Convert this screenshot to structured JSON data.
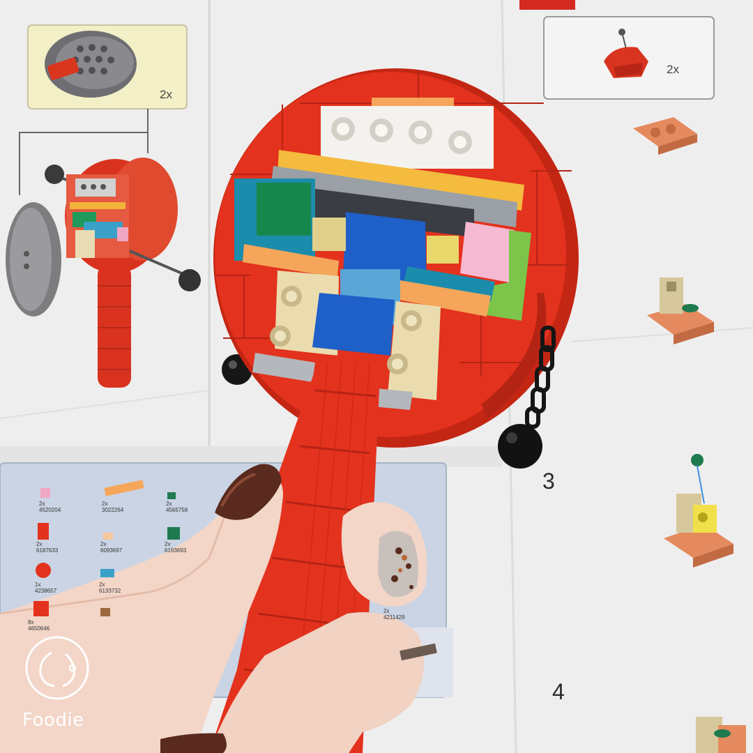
{
  "instructions": {
    "box_top_left_multiplier": "2x",
    "box_top_right_multiplier": "2x",
    "step_3": "3",
    "step_4": "4",
    "parts_list": [
      {
        "qty": "2x",
        "code": "4520204"
      },
      {
        "qty": "2x",
        "code": "3022264"
      },
      {
        "qty": "2x",
        "code": "4565758"
      },
      {
        "qty": "2x",
        "code": "6187633"
      },
      {
        "qty": "2x",
        "code": "6093697"
      },
      {
        "qty": "2x",
        "code": "6193693"
      },
      {
        "qty": "1x",
        "code": "4238657"
      },
      {
        "qty": "2x",
        "code": "6133732"
      },
      {
        "qty": "8x",
        "code": "4650646"
      },
      {
        "qty": "2x",
        "code": "4211429"
      }
    ]
  },
  "watermark": {
    "app_name": "Foodie",
    "logo_icon": "foodie-logo-icon"
  },
  "colors": {
    "brick_red": "#e0301e",
    "paper": "#ecebeb",
    "parts_panel": "#c9d3e3"
  }
}
